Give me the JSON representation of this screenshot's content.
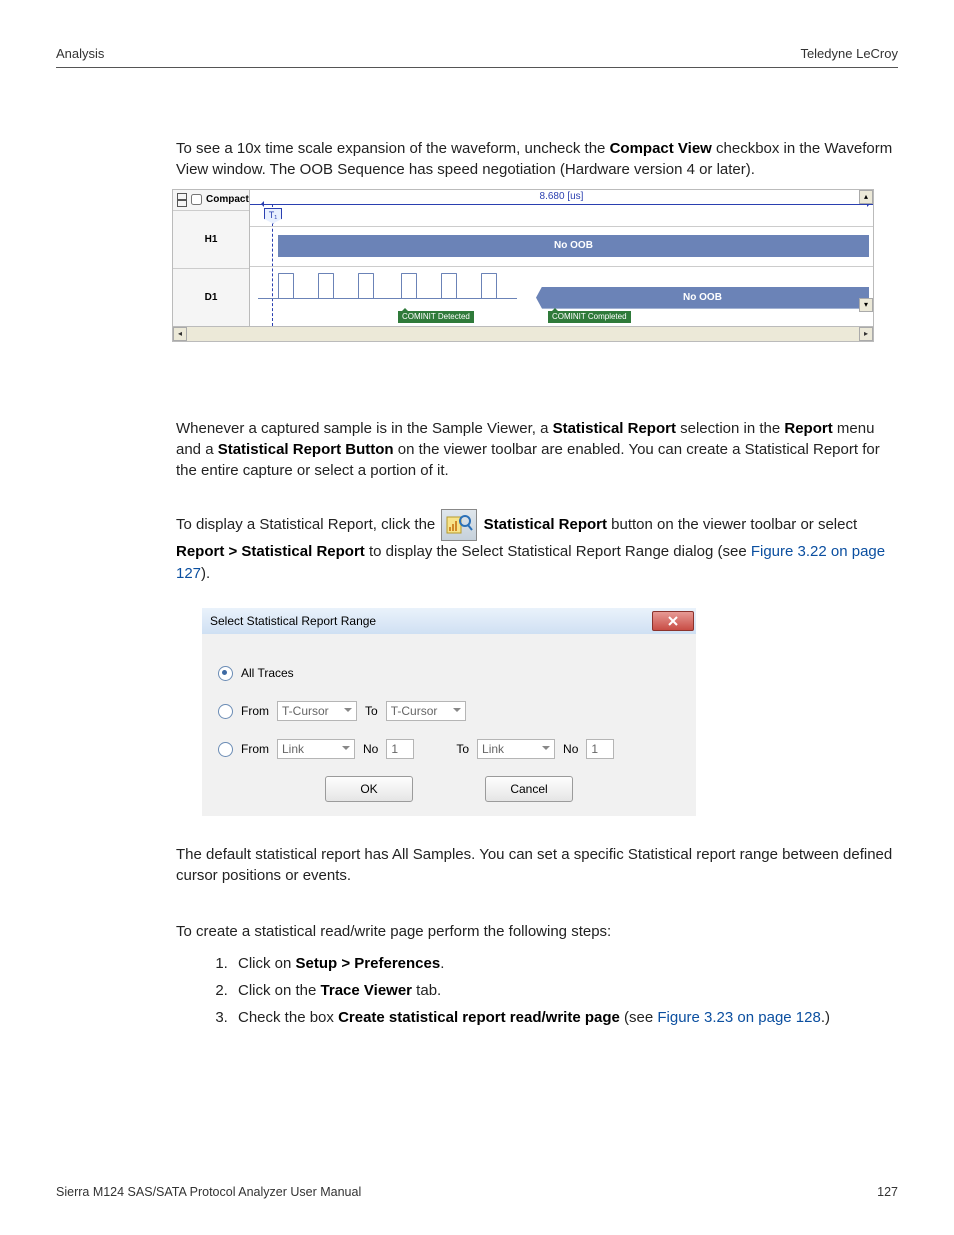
{
  "header": {
    "left": "Analysis",
    "right": "Teledyne LeCroy"
  },
  "footer": {
    "left": "Sierra M124 SAS/SATA Protocol Analyzer User Manual",
    "right": "127"
  },
  "para1_pre": "To see a 10x time scale expansion of the waveform, uncheck the ",
  "para1_bold": "Compact View",
  "para1_post": " checkbox in the Waveform View window. The OOB Sequence has speed negotiation (Hardware version 4 or later).",
  "wave": {
    "compact_label": "Compact",
    "h1_label": "H1",
    "d1_label": "D1",
    "time_label": "8.680 [us]",
    "cursor_tag": "T₁",
    "no_oob": "No OOB",
    "evt_detected": "COMINIT Detected",
    "evt_completed": "COMINIT Completed"
  },
  "para2_a": "Whenever a captured sample is in the Sample Viewer, a ",
  "para2_b": "Statistical Report",
  "para2_c": " selection in the ",
  "para2_d": "Report",
  "para2_e": " menu and a ",
  "para2_f": "Statistical Report Button",
  "para2_g": " on the viewer toolbar are enabled. You can create a Statistical Report for the entire capture or select a portion of it.",
  "para3_a": "To display a Statistical Report, click the ",
  "para3_b": "Statistical Report",
  "para3_c": " button on the viewer toolbar or select ",
  "para3_d": "Report > Statistical Report",
  "para3_e": " to display the Select Statistical Report Range dialog (see ",
  "para3_link": "Figure 3.22 on page 127",
  "para3_f": ").",
  "dialog": {
    "title": "Select Statistical Report Range",
    "opt_all": "All Traces",
    "opt_from": "From",
    "to_label": "To",
    "no_label": "No",
    "tcursor": "T-Cursor",
    "link": "Link",
    "one": "1",
    "ok": "OK",
    "cancel": "Cancel"
  },
  "para4": "The default statistical report has All Samples. You can set a specific Statistical report range between defined cursor positions or events.",
  "para5": "To create a statistical read/write page perform the following steps:",
  "steps": {
    "s1a": "Click on ",
    "s1b": "Setup > Preferences",
    "s1c": ".",
    "s2a": "Click on the ",
    "s2b": "Trace Viewer",
    "s2c": " tab.",
    "s3a": "Check the box ",
    "s3b": "Create statistical report read/write page",
    "s3c": " (see ",
    "s3link": "Figure 3.23 on page 128",
    "s3d": ".)"
  }
}
